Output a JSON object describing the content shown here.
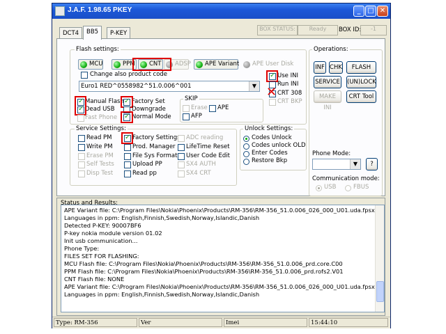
{
  "window": {
    "title": "J.A.F.  1.98.65 PKEY"
  },
  "tabs": [
    {
      "label": "DCT4"
    },
    {
      "label": "BB5"
    },
    {
      "label": "P-KEY"
    }
  ],
  "box_status": {
    "button": "BOX STATUS:",
    "value": "Ready",
    "box_id_label": "BOX ID:",
    "box_id_value": "-1"
  },
  "flash_settings": {
    "title": "Flash settings:",
    "pills": {
      "mcu": "MCU",
      "ppm": "PPM",
      "cnt": "CNT",
      "adsp": "ADSP",
      "ape_variant": "APE Variant",
      "ape_user_disk": "APE User Disk"
    },
    "change_product_code": "Change also product code",
    "product_code_value": "Euro1 RED^0558982^51.0.006^001",
    "use_ini": "Use INI",
    "run_ini": "Run INI",
    "crt308": "CRT 308",
    "crt_bkp": "CRT BKP",
    "manual_flash": "Manual Flash",
    "dead_usb": "Dead USB",
    "fast_phone": "Fast Phone",
    "factory_set": "Factory Set",
    "downgrade": "Downgrade",
    "normal_mode": "Normal Mode",
    "skip": {
      "title": "SKIP",
      "erase": "Erase",
      "ape": "APE",
      "afp": "AFP"
    }
  },
  "service_settings": {
    "title": "Service Settings:",
    "items": {
      "read_pm": "Read PM",
      "write_pm": "Write PM",
      "erase_pm": "Erase PM",
      "self_tests": "Self Tests",
      "disp_test": "Disp Test",
      "factory_settings": "Factory Settings",
      "prod_manager": "Prod. Manager",
      "file_sys_format": "File Sys Format",
      "upload_pp": "Upload PP",
      "read_pp": "Read pp",
      "adc_reading": "ADC reading",
      "lifetime_reset": "LifeTime Reset",
      "user_code_edit": "User Code Edit",
      "sx4_auth": "SX4 AUTH",
      "sx4_crt": "SX4 CRT"
    }
  },
  "unlock_settings": {
    "title": "Unlock Settings:",
    "options": [
      "Codes Unlock",
      "Codes unlock OLD",
      "Enter Codes",
      "Restore Bkp"
    ]
  },
  "operations": {
    "title": "Operations:",
    "buttons": {
      "inf": "INF",
      "chk": "CHK",
      "flash": "FLASH",
      "service": "SERVICE",
      "unlock": "(UN)LOCK",
      "make_ini": "MAKE INI",
      "crt_tool": "CRT Tool"
    }
  },
  "phone_mode": {
    "title": "Phone Mode:",
    "help": "?"
  },
  "comm_mode": {
    "title": "Communication mode:",
    "usb": "USB",
    "fbus": "FBUS"
  },
  "status": {
    "title": "Status and Results:",
    "lines": [
      "APE Variant file: C:\\Program Files\\Nokia\\Phoenix\\Products\\RM-356\\RM-356_51.0.006_026_000_U01.uda.fpsx",
      "Languages in ppm: English,Finnish,Swedish,Norway,Islandic,Danish",
      "Detected P-KEY: 90007BF6",
      "P-key nokia module version 01.02",
      "Init usb communication...",
      "Phone Type:",
      "FILES SET FOR FLASHING:",
      "MCU Flash file: C:\\Program Files\\Nokia\\Phoenix\\Products\\RM-356\\RM-356_51.0.006_prd.core.C00",
      "PPM Flash file: C:\\Program Files\\Nokia\\Phoenix\\Products\\RM-356\\RM-356_51.0.006_prd.rofs2.V01",
      "CNT Flash file: NONE",
      "APE Variant file: C:\\Program Files\\Nokia\\Phoenix\\Products\\RM-356\\RM-356_51.0.006_026_000_U01.uda.fpsx",
      "Languages in ppm: English,Finnish,Swedish,Norway,Islandic,Danish"
    ]
  },
  "statusbar": {
    "type": "Type: RM-356",
    "ver": "Ver",
    "imei": "Imei",
    "time": "15:44:10"
  },
  "colors": {
    "highlight": "#e00000",
    "title_bar": "#1c58d8"
  }
}
